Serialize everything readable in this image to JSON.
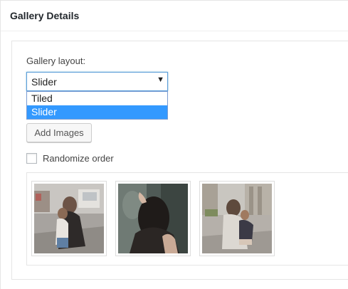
{
  "panel": {
    "title": "Gallery Details"
  },
  "layout": {
    "label": "Gallery layout:",
    "selected": "Slider",
    "caret": "▼",
    "options": [
      "Tiled",
      "Slider"
    ],
    "highlighted_option": "Slider"
  },
  "add_images_label": "Add Images",
  "randomize": {
    "label": "Randomize order",
    "checked": false
  },
  "images": [
    {
      "name": "mother-child-street-photo"
    },
    {
      "name": "woman-back-dark-hair-photo"
    },
    {
      "name": "mother-child-city-photo"
    }
  ],
  "colors": {
    "highlight": "#3399ff",
    "focus_border": "#5b9dd9"
  }
}
